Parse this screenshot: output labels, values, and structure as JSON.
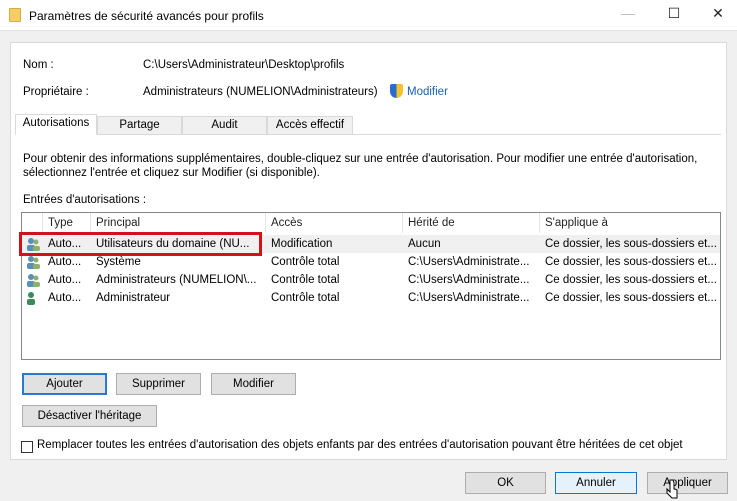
{
  "window": {
    "title": "Paramètres de sécurité avancés pour profils",
    "folder_icon": "folder-icon",
    "minimize": "—",
    "maximize": "☐",
    "close": "✕"
  },
  "info": {
    "name_label": "Nom :",
    "name_value": "C:\\Users\\Administrateur\\Desktop\\profils",
    "owner_label": "Propriétaire :",
    "owner_value": "Administrateurs (NUMELION\\Administrateurs)",
    "owner_change": "Modifier"
  },
  "tabs": [
    {
      "label": "Autorisations",
      "active": true
    },
    {
      "label": "Partage"
    },
    {
      "label": "Audit"
    },
    {
      "label": "Accès effectif"
    }
  ],
  "description": "Pour obtenir des informations supplémentaires, double-cliquez sur une entrée d'autorisation. Pour modifier une entrée d'autorisation, sélectionnez l'entrée et cliquez sur Modifier (si disponible).",
  "entries_label": "Entrées d'autorisations :",
  "columns": [
    "Type",
    "Principal",
    "Accès",
    "Hérité de",
    "S'applique à"
  ],
  "rows": [
    {
      "type": "Auto...",
      "principal": "Utilisateurs du domaine (NU...",
      "access": "Modification",
      "inherited": "Aucun",
      "applies": "Ce dossier, les sous-dossiers et...",
      "icon": "group-icon",
      "selected": true,
      "highlighted": true
    },
    {
      "type": "Auto...",
      "principal": "Système",
      "access": "Contrôle total",
      "inherited": "C:\\Users\\Administrate...",
      "applies": "Ce dossier, les sous-dossiers et...",
      "icon": "group-icon"
    },
    {
      "type": "Auto...",
      "principal": "Administrateurs (NUMELION\\...",
      "access": "Contrôle total",
      "inherited": "C:\\Users\\Administrate...",
      "applies": "Ce dossier, les sous-dossiers et...",
      "icon": "group-icon"
    },
    {
      "type": "Auto...",
      "principal": "Administrateur",
      "access": "Contrôle total",
      "inherited": "C:\\Users\\Administrate...",
      "applies": "Ce dossier, les sous-dossiers et...",
      "icon": "user-icon"
    }
  ],
  "buttons": {
    "add": "Ajouter",
    "remove": "Supprimer",
    "edit": "Modifier",
    "disable_inheritance": "Désactiver l'héritage",
    "ok": "OK",
    "cancel": "Annuler",
    "apply": "Appliquer"
  },
  "replace_checkbox": {
    "label": "Remplacer toutes les entrées d'autorisation des objets enfants par des entrées d'autorisation pouvant être héritées de cet objet",
    "checked": false
  },
  "colors": {
    "highlight": "#d0121b",
    "link": "#1a5fb4",
    "default_button_border": "#2a78d0"
  }
}
